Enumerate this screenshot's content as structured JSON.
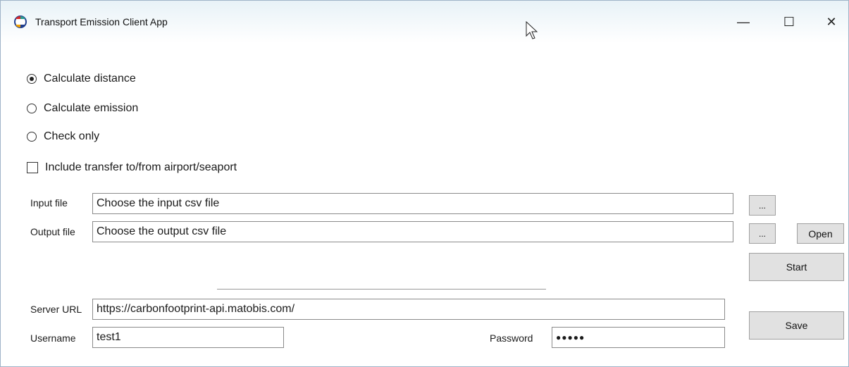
{
  "window": {
    "title": "Transport Emission Client App",
    "controls": {
      "minimize": "—",
      "maximize": "☐",
      "close": "✕"
    }
  },
  "options": {
    "radios": [
      {
        "label": "Calculate distance",
        "checked": true
      },
      {
        "label": "Calculate emission",
        "checked": false
      },
      {
        "label": "Check only",
        "checked": false
      }
    ],
    "include_transfer": {
      "label": "Include transfer to/from airport/seaport",
      "checked": false
    }
  },
  "files": {
    "input_label": "Input file",
    "input_value": "Choose the input csv file",
    "output_label": "Output file",
    "output_value": "Choose the output csv file",
    "browse_label": "...",
    "open_label": "Open",
    "start_label": "Start"
  },
  "server": {
    "url_label": "Server URL",
    "url_value": "https://carbonfootprint-api.matobis.com/",
    "username_label": "Username",
    "username_value": "test1",
    "password_label": "Password",
    "password_value": "●●●●●",
    "save_label": "Save"
  },
  "colors": {
    "titlebar": "#e8f2f7",
    "button_face": "#e1e1e1",
    "border": "#8a8a8a"
  }
}
